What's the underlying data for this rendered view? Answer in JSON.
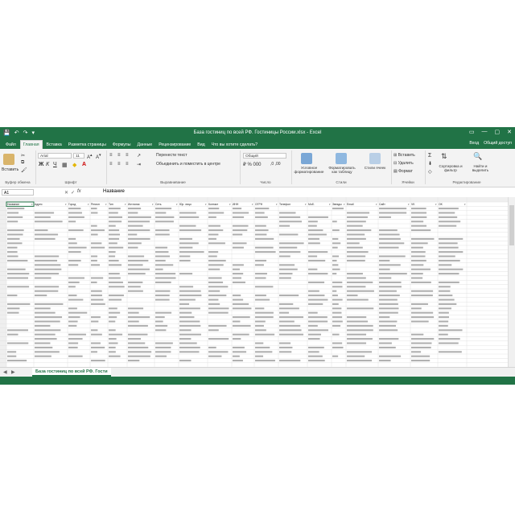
{
  "window": {
    "title": "База гостиниц по всей РФ. Гостиницы России.xlsx - Excel",
    "quick_access": [
      "💾",
      "↶",
      "↷",
      "▾"
    ],
    "controls": [
      "▭",
      "—",
      "▢",
      "✕"
    ]
  },
  "ribbon": {
    "tabs": [
      "Файл",
      "Главная",
      "Вставка",
      "Разметка страницы",
      "Формулы",
      "Данные",
      "Рецензирование",
      "Вид",
      "Что вы хотите сделать?"
    ],
    "active_tab": "Главная",
    "right": {
      "signin": "Вход",
      "share": "Общий доступ"
    },
    "clipboard": {
      "paste": "Вставить",
      "label": "Буфер обмена"
    },
    "font": {
      "name": "Arial",
      "size": "11",
      "label": "Шрифт"
    },
    "alignment": {
      "wrap": "Перенести текст",
      "merge": "Объединить и поместить в центре",
      "label": "Выравнивание"
    },
    "number": {
      "format": "Общий",
      "label": "Число"
    },
    "styles": {
      "conditional": "Условное форматирование",
      "as_table": "Форматировать как таблицу",
      "cell_styles": "Стили ячеек",
      "label": "Стили"
    },
    "cells": {
      "insert": "Вставить",
      "delete": "Удалить",
      "format": "Формат",
      "label": "Ячейки"
    },
    "editing": {
      "sort": "Сортировка и фильтр",
      "find": "Найти и выделить",
      "label": "Редактирование"
    }
  },
  "formula_bar": {
    "name_box": "A1",
    "fx": "fx",
    "value": "Название"
  },
  "sheet": {
    "headers": [
      "Название",
      "Адрес",
      "Город",
      "Регион",
      "Тип",
      "Источник",
      "Сеть",
      "Юр. лицо",
      "Контакт",
      "ИНН",
      "ОГРН",
      "Телефон",
      "Моб.",
      "Звезды",
      "Email",
      "Сайт",
      "VK",
      "OK"
    ],
    "data_preview": "Название",
    "sheet_tab": "База гостиниц по всей РФ. Гости"
  },
  "colors": {
    "excel_green": "#217346",
    "ribbon_bg": "#f3f3f3",
    "grid_line": "#e1e1e1"
  }
}
